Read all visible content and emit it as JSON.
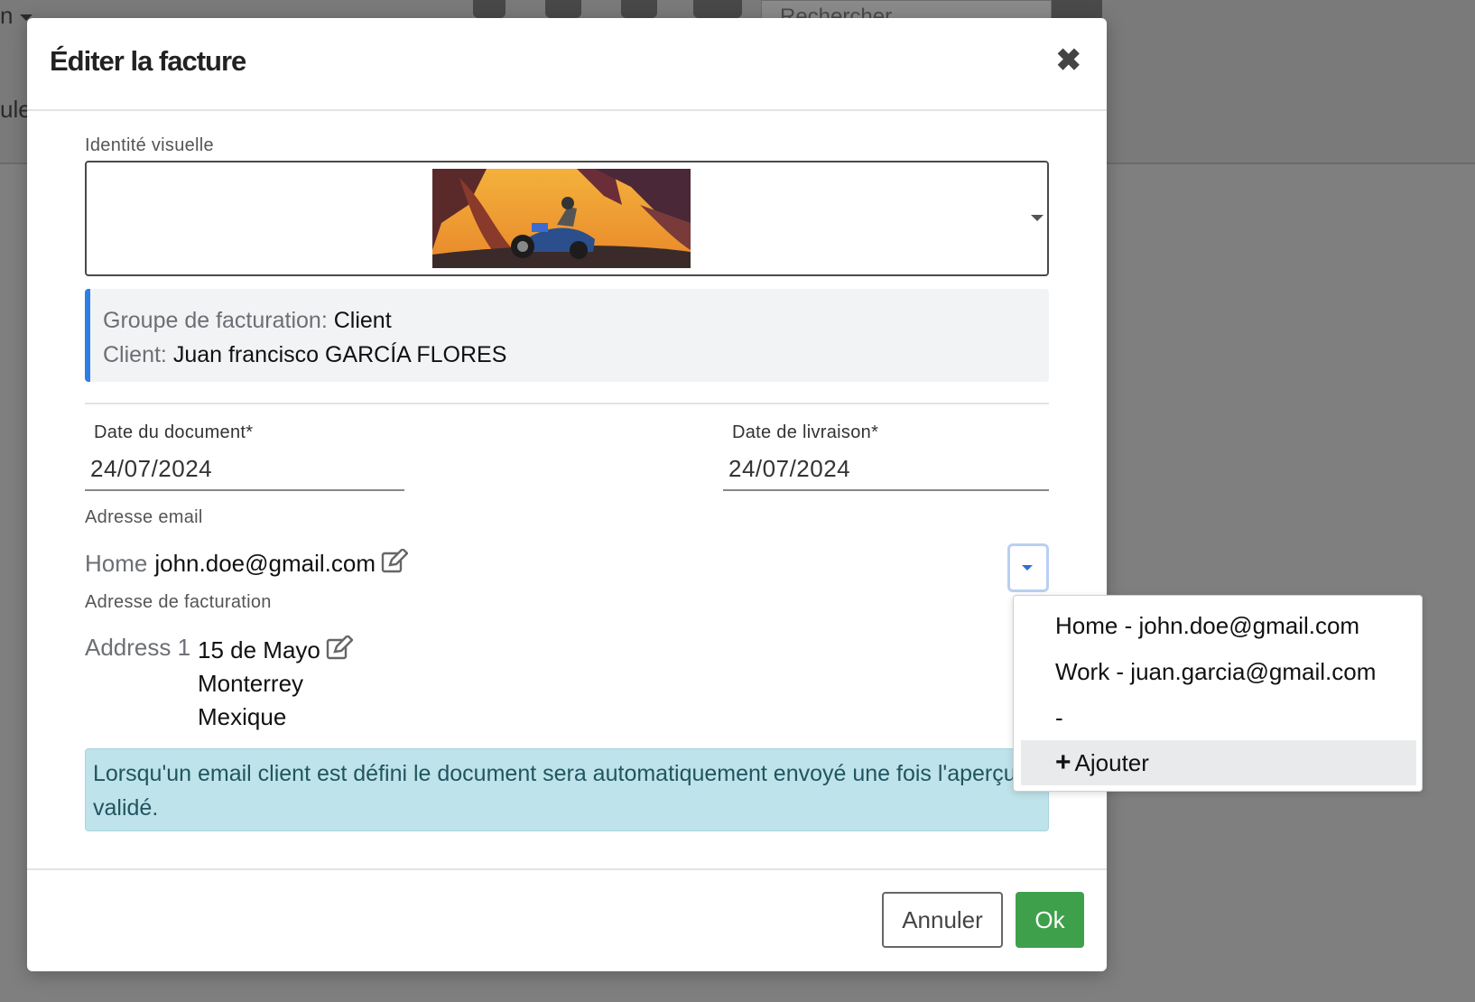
{
  "background": {
    "left_text": "n",
    "left_text2": "ule",
    "search_placeholder": "Rechercher"
  },
  "modal": {
    "title": "Éditer la facture",
    "close_symbol": "✖",
    "visual_identity_label": "Identité visuelle",
    "billing_info": {
      "group_label": "Groupe de facturation:",
      "group_value": "Client",
      "client_label": "Client:",
      "client_value": "Juan francisco GARCÍA FLORES"
    },
    "document_date": {
      "label": "Date du document*",
      "value": "24/07/2024"
    },
    "delivery_date": {
      "label": "Date de livraison*",
      "value": "24/07/2024"
    },
    "email": {
      "label": "Adresse email",
      "type": "Home",
      "value": "john.doe@gmail.com"
    },
    "billing_address": {
      "label": "Adresse de facturation",
      "name": "Address 1",
      "line1": "15 de Mayo",
      "line2": "Monterrey",
      "line3": "Mexique"
    },
    "alert_text": "Lorsqu'un email client est défini le document sera automatiquement envoyé une fois l'aperçu validé.",
    "cancel_label": "Annuler",
    "ok_label": "Ok"
  },
  "email_dropdown": {
    "items": [
      "Home - john.doe@gmail.com",
      "Work - juan.garcia@gmail.com",
      "-"
    ],
    "add_label": "Ajouter"
  },
  "colors": {
    "accent_blue": "#2f7ee6",
    "ok_green": "#3fa04b",
    "alert_bg": "#bfe3ea"
  }
}
